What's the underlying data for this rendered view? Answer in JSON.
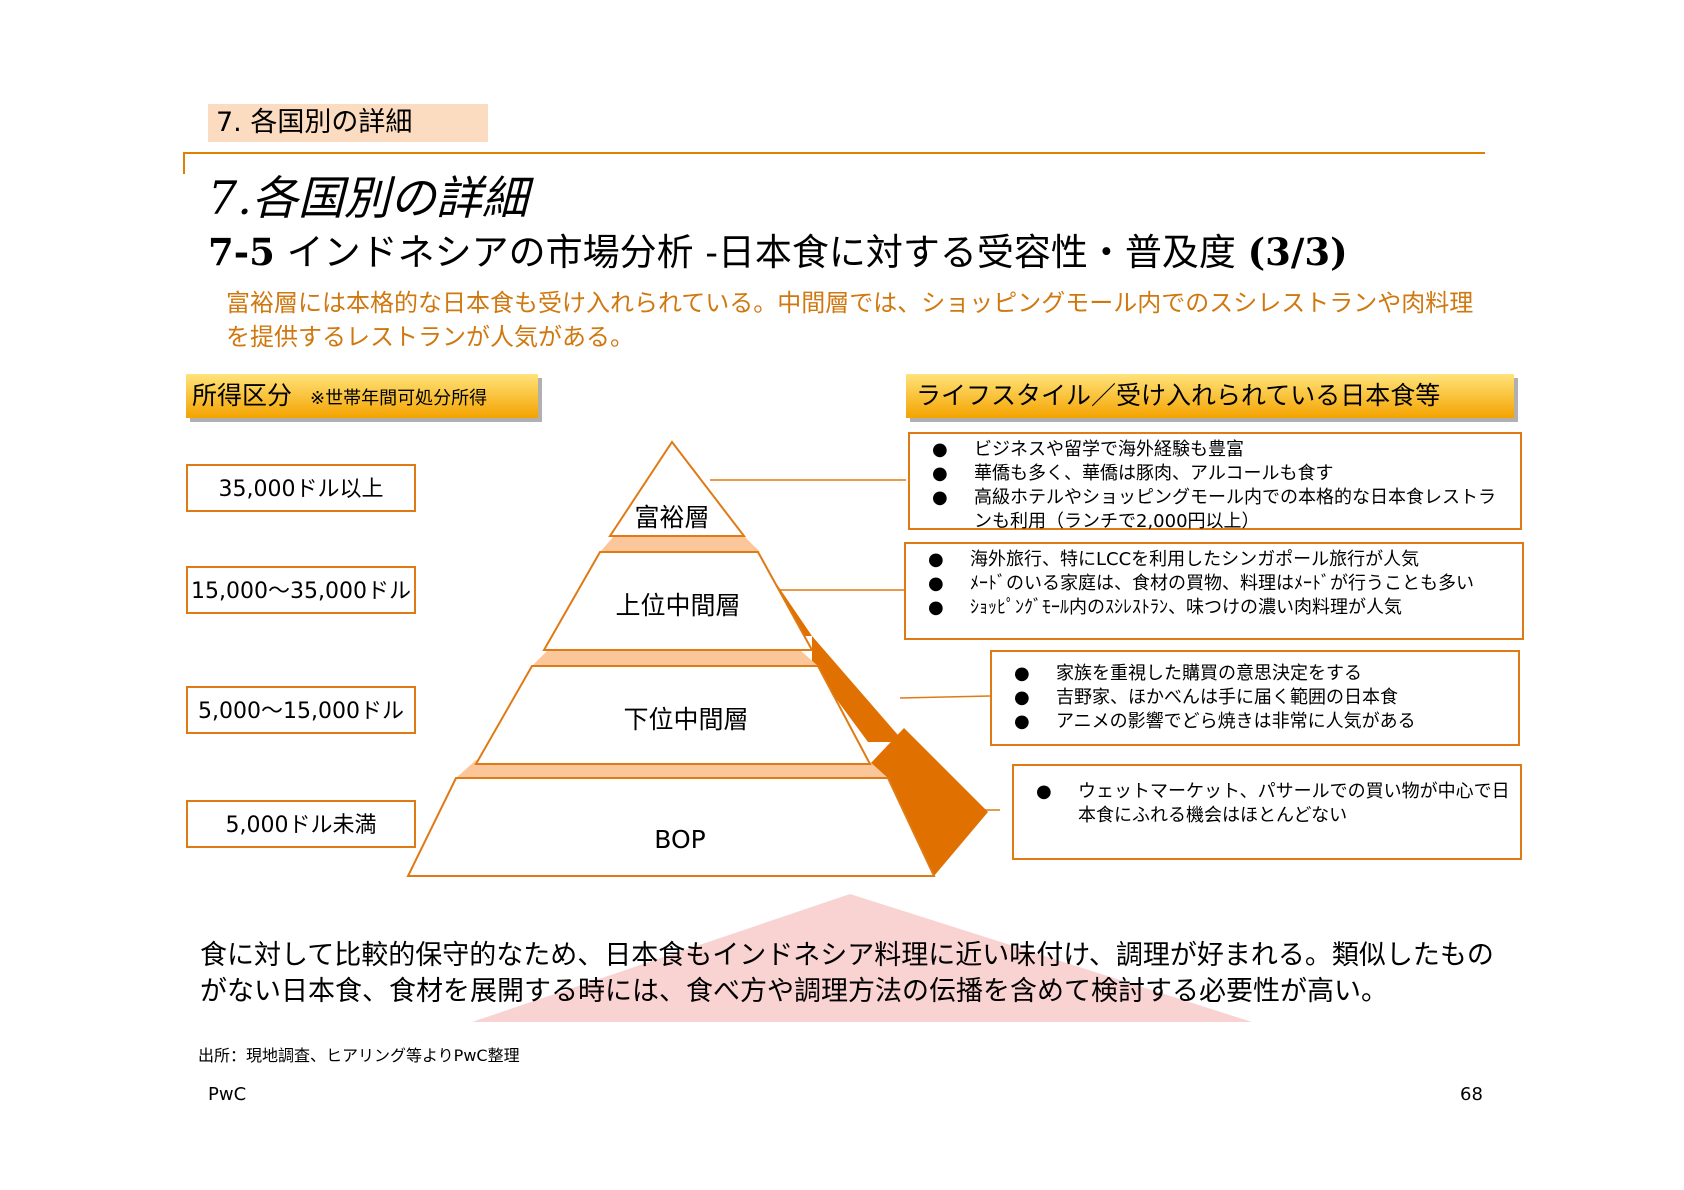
{
  "header": {
    "section_tag": "7. 各国別の詳細",
    "title": "7.各国別の詳細",
    "subtitle_num": "7-5",
    "subtitle_text": " インドネシアの市場分析 -日本食に対する受容性・普及度 ",
    "subtitle_page": "(3/3)",
    "lead": "富裕層には本格的な日本食も受け入れられている。中間層では、ショッピングモール内でのスシレストランや肉料理を提供するレストランが人気がある。"
  },
  "income": {
    "header": "所得区分",
    "note": "※世帯年間可処分所得",
    "bands": [
      "35,000ドル以上",
      "15,000～35,000ドル",
      "5,000～15,000ドル",
      "5,000ドル未満"
    ]
  },
  "pyramid": {
    "tiers": [
      "富裕層",
      "上位中間層",
      "下位中間層",
      "BOP"
    ]
  },
  "lifestyle": {
    "header": "ライフスタイル／受け入れられている日本食等",
    "bullet": "●",
    "groups": [
      [
        "ビジネスや留学で海外経験も豊富",
        "華僑も多く、華僑は豚肉、アルコールも食す",
        "高級ホテルやショッピングモール内での本格的な日本食レストランも利用（ランチで2,000円以上）"
      ],
      [
        "海外旅行、特にLCCを利用したシンガポール旅行が人気",
        "ﾒｰﾄﾞのいる家庭は、食材の買物、料理はﾒｰﾄﾞが行うことも多い",
        "ｼｮｯﾋﾟﾝｸﾞﾓｰﾙ内のｽｼﾚｽﾄﾗﾝ、味つけの濃い肉料理が人気"
      ],
      [
        "家族を重視した購買の意思決定をする",
        "吉野家、ほかべんは手に届く範囲の日本食",
        "アニメの影響でどら焼きは非常に人気がある"
      ],
      [
        "ウェットマーケット、パサールでの買い物が中心で日本食にふれる機会はほとんどない"
      ]
    ]
  },
  "conclusion": "食に対して比較的保守的なため、日本食もインドネシア料理に近い味付け、調理が好まれる。類似したものがない日本食、食材を展開する時には、食べ方や調理方法の伝播を含めて検討する必要性が高い。",
  "source": "出所：現地調査、ヒアリング等よりPwC整理",
  "footer": {
    "left": "PwC",
    "page": "68"
  },
  "colors": {
    "accent_orange": "#e07a14",
    "pyramid_side": "#e07000",
    "pyramid_step": "#fbc79a",
    "conclusion_bg": "#f9d2d2",
    "header_gold": "#f4a300"
  }
}
